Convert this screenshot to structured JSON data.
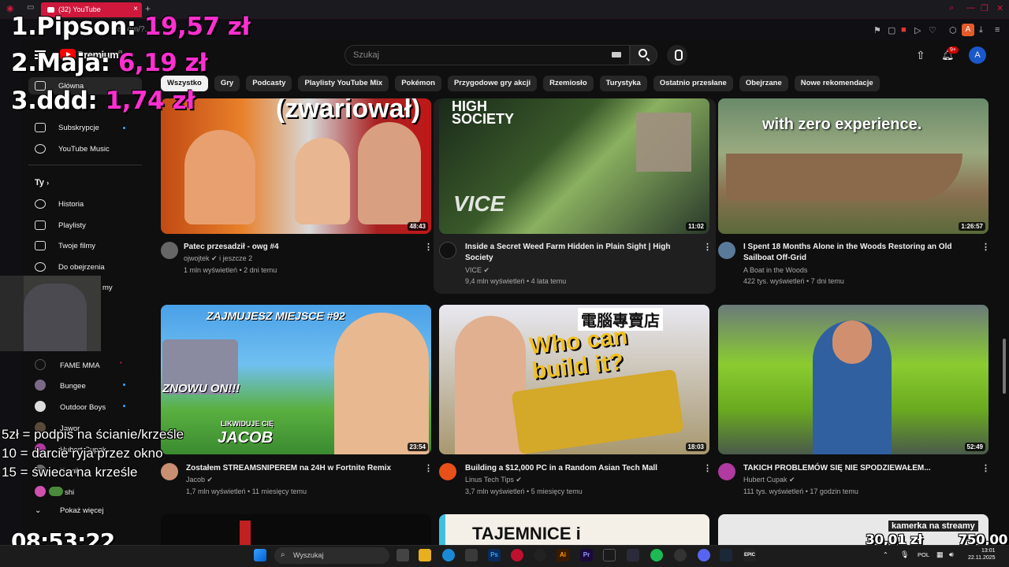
{
  "browser": {
    "tab_title": "(32) YouTube",
    "address_fragment": "e.com/?...",
    "ext_badge": "A"
  },
  "header": {
    "brand": "Premium",
    "region": "PL",
    "search_placeholder": "Szukaj",
    "notifications_badge": "9+",
    "avatar_letter": "A"
  },
  "chips": [
    "Wszystko",
    "Gry",
    "Podcasty",
    "Playlisty YouTube Mix",
    "Pokémon",
    "Przygodowe gry akcji",
    "Rzemiosło",
    "Turystyka",
    "Ostatnio przesłane",
    "Obejrzane",
    "Nowe rekomendacje"
  ],
  "sidebar": {
    "home": "Główna",
    "subscriptions": "Subskrypcje",
    "music": "YouTube Music",
    "you_header": "Ty",
    "history": "Historia",
    "playlists": "Playlisty",
    "your_videos": "Twoje filmy",
    "watch_later": "Do obejrzenia",
    "liked_partial": "my",
    "channels": [
      "FAME MMA",
      "Bungee",
      "Outdoor Boys",
      "Jawor",
      "Hubert Cupak",
      "Kamił",
      "shi"
    ],
    "show_more": "Pokaż więcej"
  },
  "videos": [
    {
      "title": "Patec przesadził - owg #4",
      "channel": "ojwojtek",
      "extra": "i jeszcze 2",
      "meta": "1 mln wyświetleń • 2 dni temu",
      "duration": "48:43",
      "thumb_text": "(zwariował)"
    },
    {
      "title": "Inside a Secret Weed Farm Hidden in Plain Sight | High Society",
      "channel": "VICE",
      "meta": "9,4 mln wyświetleń • 4 lata temu",
      "duration": "11:02",
      "thumb_text": "HIGH SOCIETY",
      "thumb_logo": "VICE"
    },
    {
      "title": "I Spent 18 Months Alone in the Woods Restoring an Old Sailboat Off-Grid",
      "channel": "A Boat in the Woods",
      "meta": "422 tys. wyświetleń • 7 dni temu",
      "duration": "1:26:57",
      "thumb_text": "with zero experience."
    },
    {
      "title": "Zostałem STREAMSNIPEREM na 24H w Fortnite Remix",
      "channel": "Jacob",
      "meta": "1,7 mln wyświetleń • 11 miesięcy temu",
      "duration": "23:54",
      "thumb_text": "ZAJMUJESZ MIEJSCE #92",
      "thumb_text2": "ZNOWU ON!!!",
      "thumb_text3": "LIKWIDUJE CIĘ",
      "thumb_text4": "JACOB"
    },
    {
      "title": "Building a $12,000 PC in a Random Asian Tech Mall",
      "channel": "Linus Tech Tips",
      "meta": "3,7 mln wyświetleń • 5 miesięcy temu",
      "duration": "18:03",
      "thumb_text": "Who can build it?",
      "thumb_sign": "電腦專賣店"
    },
    {
      "title": "TAKICH PROBLEMÓW SIĘ NIE SPODZIEWAŁEM...",
      "channel": "Hubert Cupak",
      "meta": "111 tys. wyświetleń • 17 godzin temu",
      "duration": "52:49"
    }
  ],
  "partial_row": {
    "thumb_text": "TAJEMNICE i",
    "cam_label": "kamerka na streamy"
  },
  "overlay": {
    "donors": [
      {
        "name": "1.Pipson:",
        "amount": "19,57 zł"
      },
      {
        "name": "2.Maja:",
        "amount": "6,19 zł"
      },
      {
        "name": "3.ddd:",
        "amount": "1,74 zł"
      }
    ],
    "rules": [
      "5zł = podpis na ścianie/krześle",
      "10 = darcie ryja przez okno",
      "15 = świeca na krześle"
    ],
    "clock": "08:53:22",
    "goal_current": "30,01 zł",
    "goal_target": "750,00 zł"
  },
  "taskbar": {
    "search": "Wyszukaj",
    "lang": "POL",
    "time": "13:01",
    "date": "22.11.2025"
  },
  "colors": {
    "accent": "#d0183c",
    "donor_amount": "#ff2fd0",
    "yt_red": "#ff0000"
  }
}
